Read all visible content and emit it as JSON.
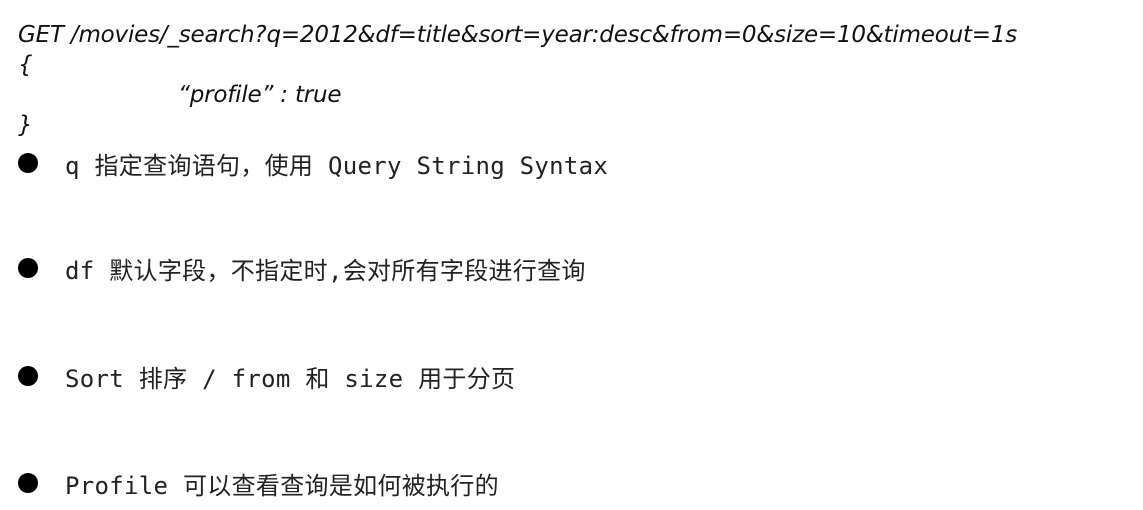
{
  "request": {
    "line1": "GET /movies/_search?q=2012&df=title&sort=year:desc&from=0&size=10&timeout=1s",
    "open_brace": "{",
    "body_line": "“profile” : true",
    "close_brace": "}"
  },
  "bullets": [
    {
      "text": "q 指定查询语句，使用 Query String Syntax"
    },
    {
      "text": "df 默认字段，不指定时,会对所有字段进行查询"
    },
    {
      "text": "Sort 排序 / from 和 size 用于分页"
    },
    {
      "text": "Profile 可以查看查询是如何被执行的"
    }
  ]
}
